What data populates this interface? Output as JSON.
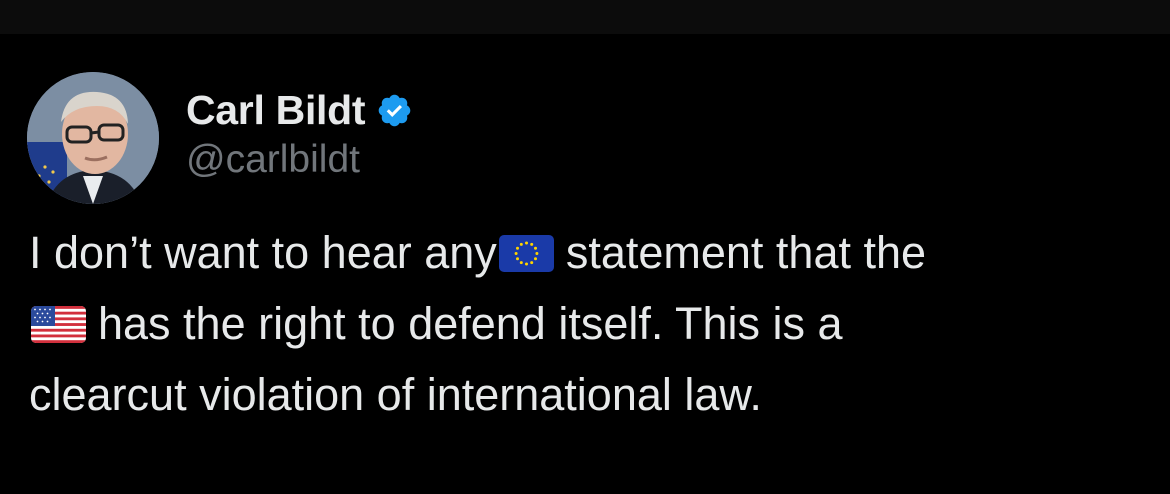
{
  "tweet": {
    "author": {
      "display_name": "Carl Bildt",
      "handle": "@carlbildt",
      "verified": true
    },
    "text": {
      "line1_before_flag": "I don’t want to hear any",
      "line1_after_flag": "statement that the",
      "line2_after_flag": "has the right to defend itself. This is a",
      "line3": "clearcut violation of international law."
    },
    "emoji": {
      "first": "eu-flag-icon",
      "second": "us-flag-icon"
    }
  },
  "colors": {
    "background": "#000000",
    "text_primary": "#e7e9ea",
    "text_secondary": "#71767b",
    "verified_blue": "#1d9bf0"
  }
}
